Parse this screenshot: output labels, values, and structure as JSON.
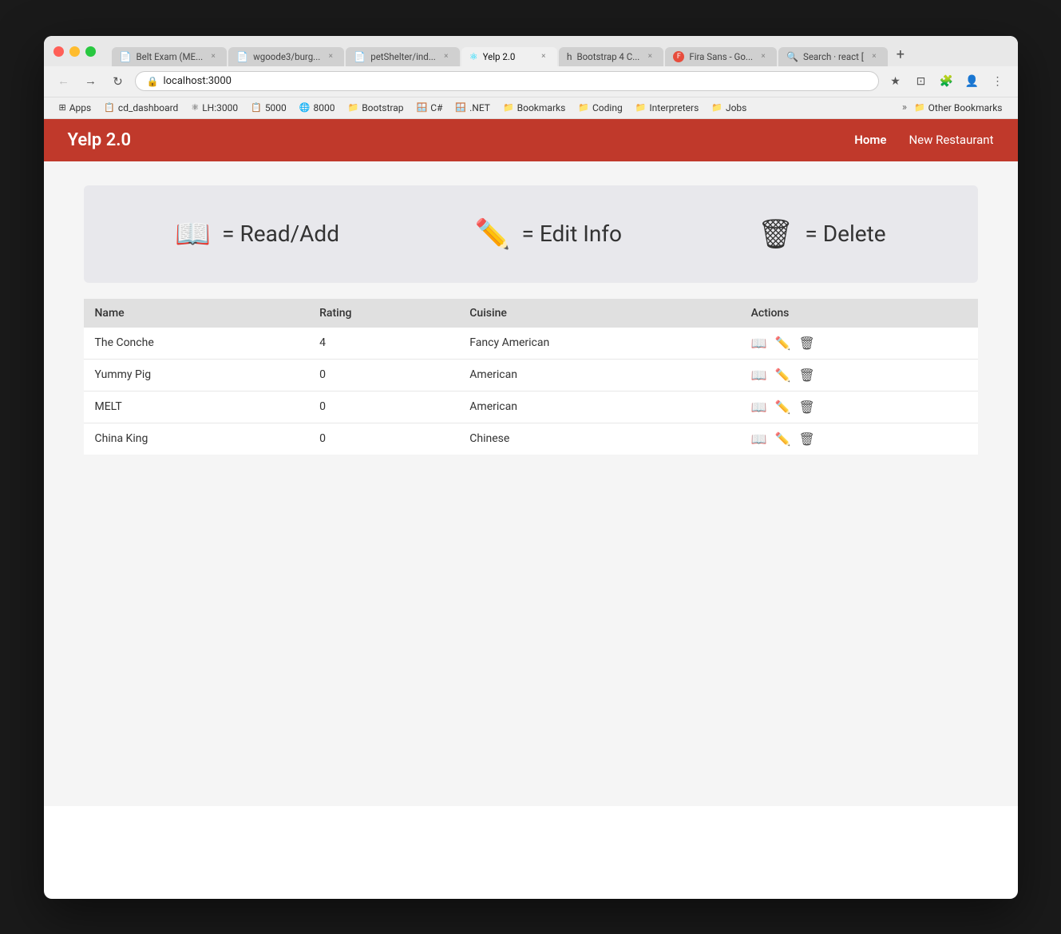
{
  "browser": {
    "tabs": [
      {
        "id": 1,
        "label": "Belt Exam (ME...",
        "icon": "📄",
        "active": false,
        "closeable": true
      },
      {
        "id": 2,
        "label": "wgoode3/burg...",
        "icon": "📄",
        "active": false,
        "closeable": true
      },
      {
        "id": 3,
        "label": "petShelter/ind...",
        "icon": "📄",
        "active": false,
        "closeable": true
      },
      {
        "id": 4,
        "label": "Yelp 2.0",
        "icon": "⚛",
        "active": true,
        "closeable": true
      },
      {
        "id": 5,
        "label": "Bootstrap 4 C...",
        "icon": "h",
        "active": false,
        "closeable": true
      },
      {
        "id": 6,
        "label": "Fira Sans - Go...",
        "icon": "F",
        "active": false,
        "closeable": true
      },
      {
        "id": 7,
        "label": "Search · react [",
        "icon": "🔍",
        "active": false,
        "closeable": true
      }
    ],
    "address": "localhost:3000",
    "bookmarks": [
      {
        "label": "Apps",
        "icon": "⊞"
      },
      {
        "label": "cd_dashboard",
        "icon": "📋"
      },
      {
        "label": "LH:3000",
        "icon": "⚛"
      },
      {
        "label": "5000",
        "icon": "📋"
      },
      {
        "label": "8000",
        "icon": "🌐"
      },
      {
        "label": "Bootstrap",
        "icon": "📁"
      },
      {
        "label": "C#",
        "icon": "🪟"
      },
      {
        "label": ".NET",
        "icon": "🪟"
      },
      {
        "label": "Bookmarks",
        "icon": "📁"
      },
      {
        "label": "Coding",
        "icon": "📁"
      },
      {
        "label": "Interpreters",
        "icon": "📁"
      },
      {
        "label": "Jobs",
        "icon": "📁"
      }
    ],
    "other_bookmarks": "Other Bookmarks"
  },
  "app": {
    "brand": "Yelp 2.0",
    "nav_links": [
      {
        "label": "Home",
        "active": true
      },
      {
        "label": "New Restaurant",
        "active": false
      }
    ],
    "legend": [
      {
        "emoji": "📖",
        "label": "= Read/Add"
      },
      {
        "emoji": "✏️",
        "label": "= Edit Info"
      },
      {
        "emoji": "🗑",
        "label": "= Delete"
      }
    ],
    "table": {
      "headers": [
        "Name",
        "Rating",
        "Cuisine",
        "Actions"
      ],
      "rows": [
        {
          "name": "The Conche",
          "rating": "4",
          "cuisine": "Fancy American"
        },
        {
          "name": "Yummy Pig",
          "rating": "0",
          "cuisine": "American"
        },
        {
          "name": "MELT",
          "rating": "0",
          "cuisine": "American"
        },
        {
          "name": "China King",
          "rating": "0",
          "cuisine": "Chinese"
        }
      ]
    }
  }
}
